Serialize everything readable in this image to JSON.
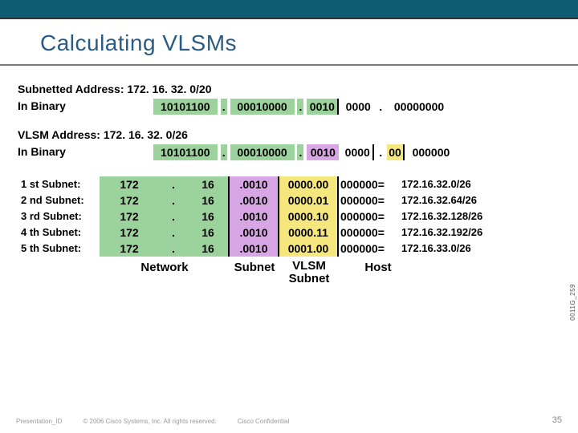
{
  "title": "Calculating VLSMs",
  "subnetted": {
    "label": "Subnetted Address:",
    "value": "172. 16. 32. 0/20",
    "binary_label": "In Binary",
    "oct1": "10101100",
    "dot1": ".",
    "oct2": "00010000",
    "dot2": ".",
    "hi4": "0010",
    "lo4": "0000",
    "dot3": ".",
    "oct4": "00000000"
  },
  "vlsm": {
    "label": "VLSM Address:",
    "value": "172. 16. 32. 0/26",
    "binary_label": "In Binary",
    "oct1": "10101100",
    "dot1": ".",
    "oct2": "00010000",
    "dot2": ".",
    "hi4": "0010",
    "lo4": "0000",
    "dot3": ".",
    "vlsm2": "00",
    "host6": "000000"
  },
  "rows": [
    {
      "label": "1 st Subnet:",
      "o1": "172",
      "d1": ".",
      "o2": "16",
      "sub": ".0010",
      "vlsm": "0000.00",
      "host": "000000=",
      "result": "172.16.32.0/26"
    },
    {
      "label": "2 nd Subnet:",
      "o1": "172",
      "d1": ".",
      "o2": "16",
      "sub": ".0010",
      "vlsm": "0000.01",
      "host": "000000=",
      "result": "172.16.32.64/26"
    },
    {
      "label": "3 rd Subnet:",
      "o1": "172",
      "d1": ".",
      "o2": "16",
      "sub": ".0010",
      "vlsm": "0000.10",
      "host": "000000=",
      "result": "172.16.32.128/26"
    },
    {
      "label": "4 th Subnet:",
      "o1": "172",
      "d1": ".",
      "o2": "16",
      "sub": ".0010",
      "vlsm": "0000.11",
      "host": "000000=",
      "result": "172.16.32.192/26"
    },
    {
      "label": "5 th Subnet:",
      "o1": "172",
      "d1": ".",
      "o2": "16",
      "sub": ".0010",
      "vlsm": "0001.00",
      "host": "000000=",
      "result": "172.16.33.0/26"
    }
  ],
  "headers": {
    "network": "Network",
    "subnet": "Subnet",
    "vlsm_subnet_l1": "VLSM",
    "vlsm_subnet_l2": "Subnet",
    "host": "Host"
  },
  "side_id": "0011G_259",
  "footer": {
    "pres_id": "Presentation_ID",
    "copyright": "© 2006 Cisco Systems, Inc. All rights reserved.",
    "confidential": "Cisco Confidential",
    "page": "35"
  }
}
